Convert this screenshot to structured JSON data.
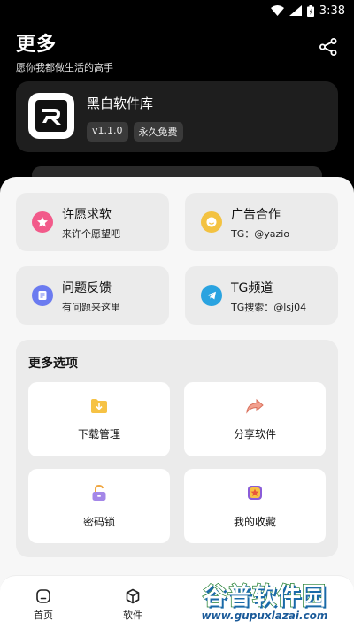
{
  "status_bar": {
    "time": "3:38"
  },
  "header": {
    "title": "更多",
    "subtitle": "愿你我都做生活的高手"
  },
  "app": {
    "name": "黑白软件库",
    "version": "v1.1.0",
    "tag": "永久免费"
  },
  "tiles": [
    {
      "title": "许愿求软",
      "subtitle": "来许个愿望吧",
      "icon": "star-icon",
      "color": "#f25a8a"
    },
    {
      "title": "广告合作",
      "subtitle": "TG：@yazio",
      "icon": "smile-icon",
      "color": "#f3c241"
    },
    {
      "title": "问题反馈",
      "subtitle": "有问题来这里",
      "icon": "feedback-icon",
      "color": "#6b7bf0"
    },
    {
      "title": "TG频道",
      "subtitle": "TG搜索：@lsj04",
      "icon": "telegram-icon",
      "color": "#2aa3e0"
    }
  ],
  "more": {
    "title": "更多选项",
    "options": [
      {
        "label": "下载管理",
        "icon": "download-folder-icon"
      },
      {
        "label": "分享软件",
        "icon": "share-arrow-icon"
      },
      {
        "label": "密码锁",
        "icon": "padlock-icon"
      },
      {
        "label": "我的收藏",
        "icon": "favorite-icon"
      }
    ]
  },
  "nav": [
    {
      "label": "首页",
      "icon": "home-icon"
    },
    {
      "label": "软件",
      "icon": "box-icon"
    }
  ],
  "watermark": {
    "big": "谷普软件园",
    "small": "www.gupuxlazai.com"
  }
}
